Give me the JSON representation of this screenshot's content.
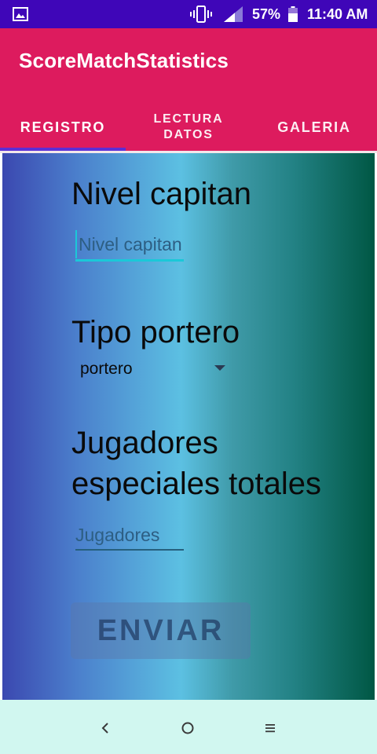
{
  "status_bar": {
    "battery_percent": "57%",
    "time": "11:40 AM"
  },
  "app_bar": {
    "title": "ScoreMatchStatistics",
    "tabs": [
      {
        "label": "REGISTRO",
        "selected": true
      },
      {
        "label_line1": "LECTURA",
        "label_line2": "DATOS",
        "selected": false
      },
      {
        "label": "GALERIA",
        "selected": false
      }
    ]
  },
  "form": {
    "captain_level": {
      "label": "Nivel capitan",
      "placeholder": "Nivel capitan",
      "value": ""
    },
    "goalkeeper_type": {
      "label": "Tipo portero",
      "selected": "portero"
    },
    "special_players": {
      "label_line1": "Jugadores",
      "label_line2": "especiales totales",
      "placeholder": "Jugadores",
      "value": ""
    },
    "submit_label": "ENVIAR"
  },
  "colors": {
    "status_bar": "#3f06b8",
    "app_bar": "#dd1b5e",
    "tab_indicator": "#5b2fd6",
    "nav_bar": "#d1f7f0"
  }
}
